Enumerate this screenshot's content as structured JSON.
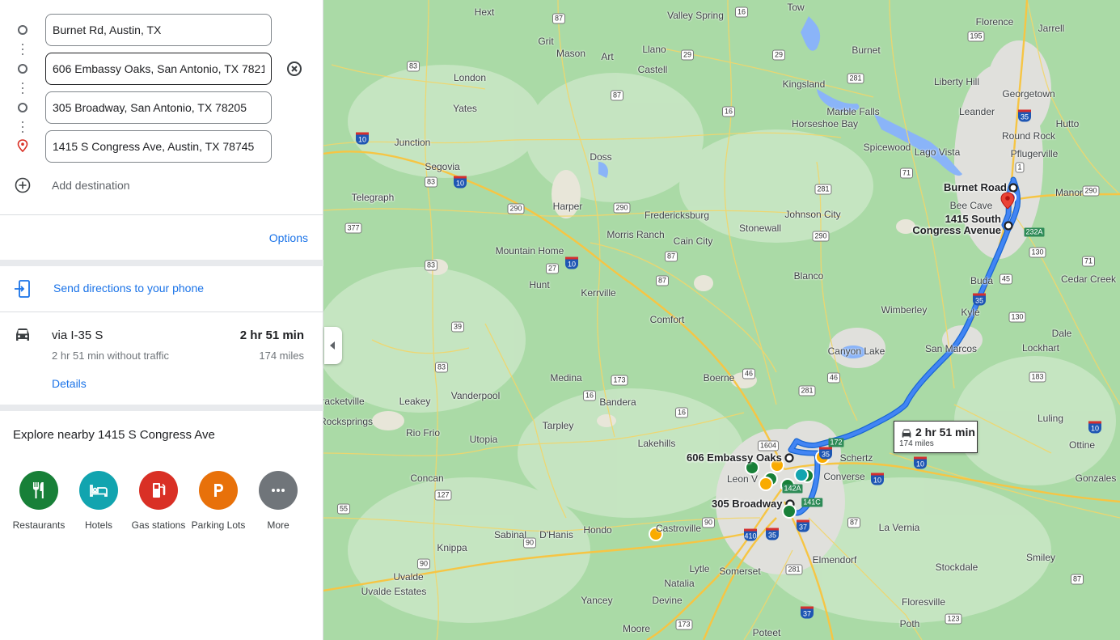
{
  "directions": {
    "stops": [
      {
        "value": "Burnet Rd, Austin, TX"
      },
      {
        "value": "606 Embassy Oaks, San Antonio, TX 78216"
      },
      {
        "value": "305 Broadway, San Antonio, TX 78205"
      },
      {
        "value": "1415 S Congress Ave, Austin, TX 78745"
      }
    ],
    "add_destination": "Add destination",
    "options_label": "Options",
    "send_to_phone": "Send directions to your phone"
  },
  "route": {
    "via": "via I-35 S",
    "duration": "2 hr 51 min",
    "traffic_note": "2 hr 51 min without traffic",
    "distance": "174 miles",
    "details_label": "Details"
  },
  "explore": {
    "title": "Explore nearby 1415 S Congress Ave",
    "categories": [
      {
        "label": "Restaurants",
        "icon": "restaurant-icon",
        "color": "#188038"
      },
      {
        "label": "Hotels",
        "icon": "hotel-icon",
        "color": "#12a4af"
      },
      {
        "label": "Gas stations",
        "icon": "gas-station-icon",
        "color": "#d93025"
      },
      {
        "label": "Parking Lots",
        "icon": "parking-icon",
        "color": "#e8710a"
      },
      {
        "label": "More",
        "icon": "more-icon",
        "color": "#70757a"
      }
    ]
  },
  "map": {
    "towns": [
      "Hext",
      "Valley Spring",
      "Tow",
      "Florence",
      "Jarrell",
      "Grit",
      "Mason",
      "Art",
      "Llano",
      "Burnet",
      "Castell",
      "London",
      "Kingsland",
      "Liberty Hill",
      "Georgetown",
      "Yates",
      "Marble Falls",
      "Leander",
      "Hutto",
      "Horseshoe Bay",
      "Round Rock",
      "Junction",
      "Doss",
      "Spicewood",
      "Lago Vista",
      "Pflugerville",
      "Segovia",
      "Bee Cave",
      "Manor",
      "Telegraph",
      "Harper",
      "Fredericksburg",
      "Johnson City",
      "Stonewall",
      "Morris Ranch",
      "Cain City",
      "Mountain Home",
      "Hunt",
      "Kerrville",
      "Blanco",
      "Cedar Creek",
      "Buda",
      "Kyle",
      "Wimberley",
      "Comfort",
      "Dale",
      "Canyon Lake",
      "San Marcos",
      "Lockhart",
      "Medina",
      "Boerne",
      "Bandera",
      "Vanderpool",
      "Leakey",
      "Tarpley",
      "Luling",
      "Rio Frio",
      "Utopia",
      "Lakehills",
      "Schertz",
      "Ottine",
      "Concan",
      "Leon V",
      "Converse",
      "Gonzales",
      "Hondo",
      "Castroville",
      "La Vernia",
      "D'Hanis",
      "Sabinal",
      "Knippa",
      "Elmendorf",
      "Smiley",
      "Lytle",
      "Somerset",
      "Stockdale",
      "Uvalde",
      "Natalia",
      "Uvalde Estates",
      "Yancey",
      "Devine",
      "Floresville",
      "Moore",
      "Poteet",
      "Poth",
      "Telegraph",
      "Bracketville",
      "Rocksprings"
    ],
    "labels": {
      "burnet_road": "Burnet Road",
      "congress_line1": "1415 South",
      "congress_line2": "Congress Avenue",
      "embassy_oaks": "606 Embassy Oaks",
      "broadway": "305 Broadway"
    },
    "eta_duration": "2 hr 51 min",
    "eta_distance": "174 miles",
    "route_color": "#1a73e8"
  }
}
